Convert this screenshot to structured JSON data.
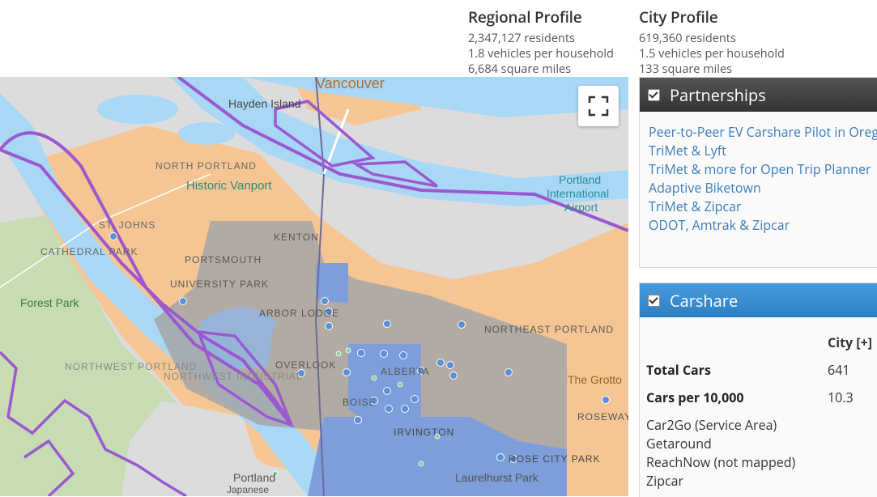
{
  "regional_profile": {
    "title": "Regional Profile",
    "residents": "2,347,127 residents",
    "vehicles": "1.8 vehicles per household",
    "area": "6,684 square miles"
  },
  "city_profile": {
    "title": "City Profile",
    "residents": "619,360 residents",
    "vehicles": "1.5 vehicles per household",
    "area": "133 square miles"
  },
  "map": {
    "labels": {
      "vancouver": "Vancouver",
      "hayden_island": "Hayden Island",
      "north_portland": "NORTH PORTLAND",
      "historic_vanport": "Historic Vanport",
      "portland_airport": "Portland International Airport",
      "st_johns": "ST. JOHNS",
      "cathedral_park": "CATHEDRAL PARK",
      "kenton": "KENTON",
      "portsmouth": "PORTSMOUTH",
      "university_park": "UNIVERSITY PARK",
      "forest_park": "Forest Park",
      "arbor_lodge": "ARBOR LODGE",
      "northeast_portland": "NORTHEAST PORTLAND",
      "overlook": "OVERLOOK",
      "alberta": "ALBERTA",
      "northwest_portland": "NORTHWEST PORTLAND",
      "northwest_industrial": "NORTHWEST INDUSTRIAL",
      "the_grotto": "The Grotto",
      "roseway": "ROSEWAY",
      "boise": "BOISE",
      "irvington": "IRVINGTON",
      "rose_city_park": "ROSE CITY PARK",
      "portland": "Portland",
      "laurelhurst": "Laurelhurst Park",
      "japanese": "Japanese"
    },
    "colors": {
      "water": "#a8d8f5",
      "land": "#d9d9d9",
      "orange": "#f5c694",
      "gray_zone": "#a6a6a6",
      "blue_zone": "#7d9edb",
      "purple_boundary": "#9b59d0",
      "marker": "#5b8fd6"
    }
  },
  "partnerships": {
    "title": "Partnerships",
    "items": [
      "Peer-to-Peer EV Carshare Pilot in Oregon",
      "TriMet & Lyft",
      "TriMet & more for Open Trip Planner",
      "Adaptive Biketown",
      "TriMet & Zipcar",
      "ODOT, Amtrak & Zipcar"
    ]
  },
  "carshare": {
    "title": "Carshare",
    "column_header": "City [+]",
    "rows": [
      {
        "label": "Total Cars",
        "value": "641"
      },
      {
        "label": "Cars per 10,000",
        "value": "10.3"
      }
    ],
    "providers": [
      "Car2Go (Service Area)",
      "Getaround",
      "ReachNow (not mapped)",
      "Zipcar"
    ]
  }
}
